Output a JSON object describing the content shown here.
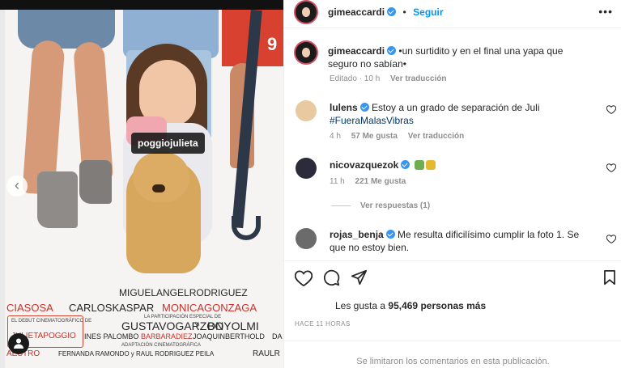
{
  "poster": {
    "tag_label": "poggiojulieta",
    "skirt_number": "9",
    "credits": {
      "miguel": "MIGUELANGELRODRIGUEZ",
      "sosa": "CIASOSA",
      "kaspar": "CARLOSKASPAR",
      "monica": "MONICAGONZAGA",
      "participacion": "LA PARTICIPACIÓN ESPECIAL DE",
      "garzon": "GUSTAVOGARZON",
      "y": "Y",
      "olmi": "BOYOLMI",
      "debut": "EL DEBUT CINEMATOGRÁFICO DE",
      "poggio": "JULIETAPOGGIO",
      "palombo": "INES PALOMBO",
      "diez": "BARBARADIEZ",
      "berthold": "JOAQUINBERTHOLD",
      "da": "DA",
      "adaptacion": "ADAPTACIÓN CINEMATOGRÁFICA",
      "maestro": "AESTRO",
      "ramondo": "FERNANDA RAMONDO y RAUL RODRIGUEZ PEILA",
      "raul": "RAULR"
    }
  },
  "header": {
    "username": "gimeaccardi",
    "separator": "•",
    "follow_label": "Seguir",
    "more": "•••"
  },
  "caption": {
    "username": "gimeaccardi",
    "text": "•un surtidito y en el final una yapa que seguro no sabían•",
    "time": "Editado · 10 h",
    "translate": "Ver traducción"
  },
  "comments": [
    {
      "username": "lulens",
      "text": "Estoy a un grado de separación de Juli",
      "hashtag": "#FueraMalasVibras",
      "time": "4 h",
      "likes": "57 Me gusta",
      "translate": "Ver traducción"
    },
    {
      "username": "nicovazquezok",
      "time": "11 h",
      "likes": "221 Me gusta",
      "replies": "Ver respuestas (1)",
      "emoji_colors": [
        "#6fae4f",
        "#e5b92f"
      ]
    },
    {
      "username": "rojas_benja",
      "text": "Me resulta dificilísimo cumplir la foto 1. Se que no estoy bien."
    }
  ],
  "footer": {
    "likes_prefix": "Les gusta a",
    "likes_count": "95,469",
    "likes_suffix": "personas más",
    "time_ago": "HACE 11 HORAS",
    "comments_limited": "Se limitaron los comentarios en esta publicación."
  },
  "icons": [
    "heart-icon",
    "comment-icon",
    "share-icon",
    "bookmark-icon",
    "verified-icon",
    "user-tag-icon",
    "chevron-left-icon"
  ],
  "colors": {
    "accent": "#0095f6",
    "verified": "#3797f0",
    "hashtag": "#00376b",
    "muted": "#8e8e8e",
    "poster_red": "#c9312a"
  }
}
